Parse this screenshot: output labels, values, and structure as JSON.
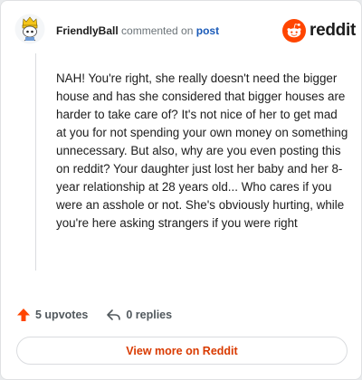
{
  "header": {
    "username": "FriendlyBall",
    "commented_text": "commented on",
    "post_link": "post",
    "brand": "reddit"
  },
  "comment": {
    "body": "NAH! You're right, she really doesn't need the bigger house and has she considered that bigger houses are harder to take care of? It's not nice of her to get mad at you for not spending your own money on something unnecessary. But also, why are you even posting this on reddit? Your daughter just lost her baby and her 8-year relationship at 28 years old... Who cares if you were an asshole or not. She's obviously hurting, while you're here asking strangers if you were right"
  },
  "actions": {
    "upvotes_label": "5 upvotes",
    "replies_label": "0 replies"
  },
  "footer": {
    "view_more_label": "View more on Reddit"
  },
  "icons": {
    "upvote": "upvote-arrow-icon",
    "reply": "reply-arrow-icon",
    "logo": "reddit-snoo-icon"
  },
  "colors": {
    "brand_orange": "#ff4500",
    "link_blue": "#1a5ab8",
    "view_more_text": "#d93a00",
    "upvote_arrow": "#ff4500"
  }
}
